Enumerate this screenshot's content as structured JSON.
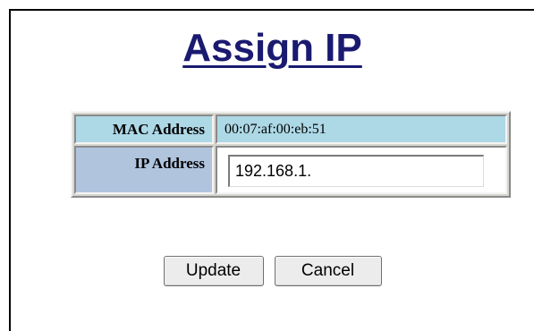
{
  "page": {
    "title": "Assign IP"
  },
  "form": {
    "mac_label": "MAC Address",
    "mac_value": "00:07:af:00:eb:51",
    "ip_label": "IP Address",
    "ip_value": "192.168.1."
  },
  "buttons": {
    "update_label": "Update",
    "cancel_label": "Cancel"
  },
  "colors": {
    "title": "#1a1a70",
    "mac_row_bg": "#add8e6",
    "ip_label_bg": "#b0c4de"
  }
}
